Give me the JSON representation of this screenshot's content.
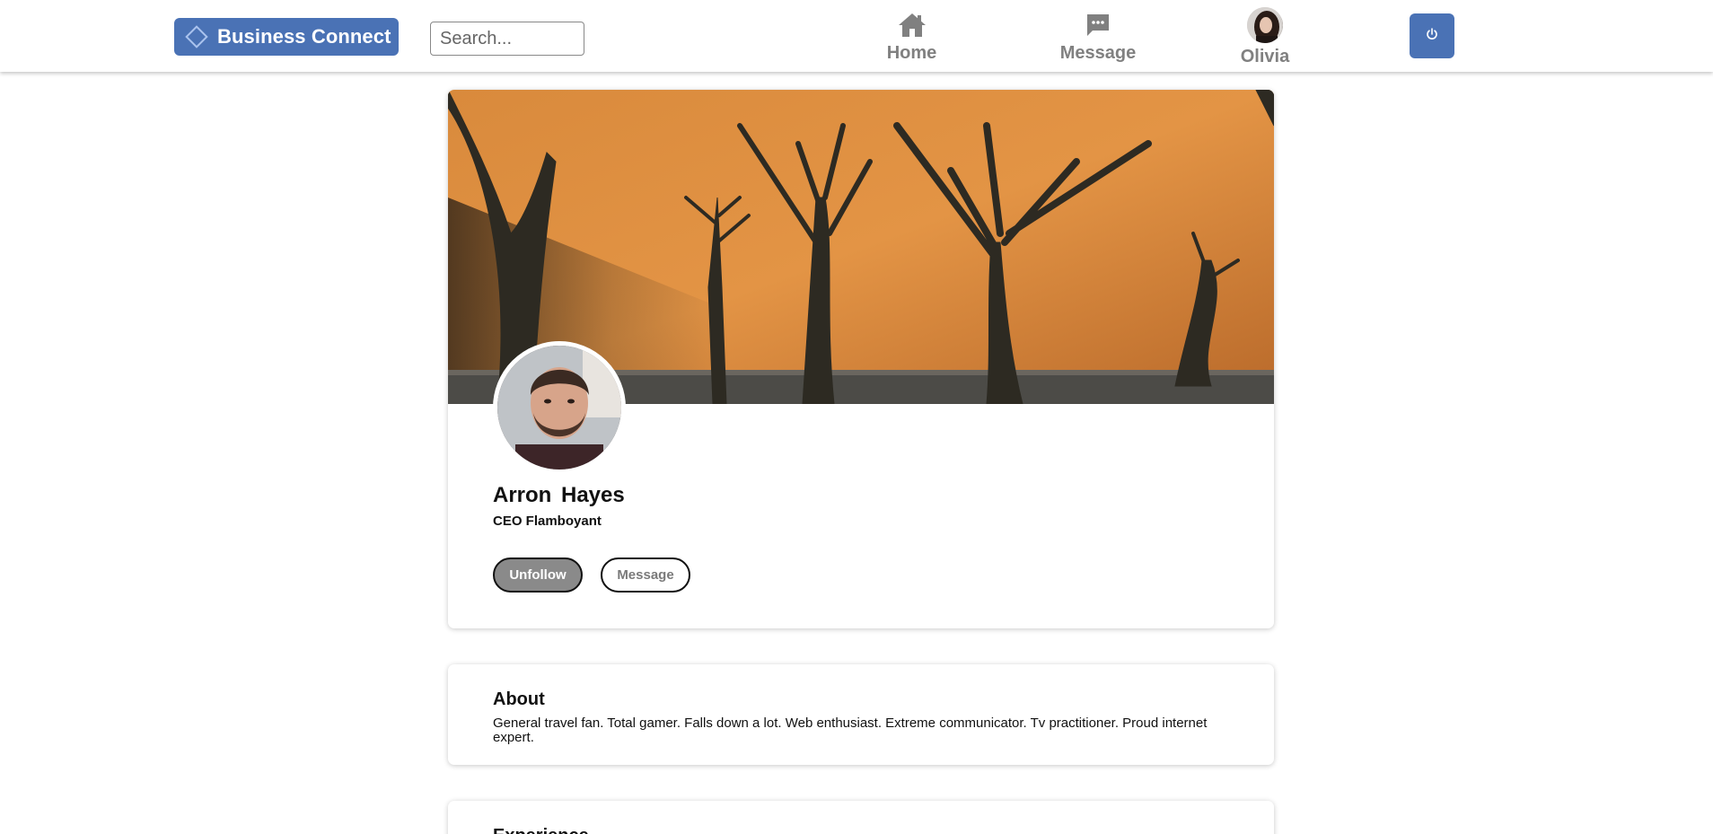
{
  "header": {
    "brand_name": "Business Connect",
    "brand_color": "#4a72b5",
    "search": {
      "placeholder": "Search...",
      "value": ""
    },
    "nav": [
      {
        "label": "Home",
        "icon": "home-icon"
      },
      {
        "label": "Message",
        "icon": "chat-bubble-icon"
      },
      {
        "label": "Olivia",
        "icon": "avatar"
      }
    ],
    "power_icon": "power-icon"
  },
  "profile": {
    "banner_alt": "desert-dead-trees-banner",
    "name": "Arron  Hayes",
    "title": "CEO Flamboyant",
    "actions": {
      "unfollow": "Unfollow",
      "message": "Message"
    }
  },
  "about": {
    "heading": "About",
    "text": "General travel fan. Total gamer. Falls down a lot. Web enthusiast. Extreme communicator. Tv practitioner. Proud internet expert."
  },
  "experience": {
    "heading": "Experience"
  },
  "colors": {
    "accent": "#4a72b5",
    "nav_text": "#808080",
    "unfollow_bg": "#8a8a8a"
  }
}
